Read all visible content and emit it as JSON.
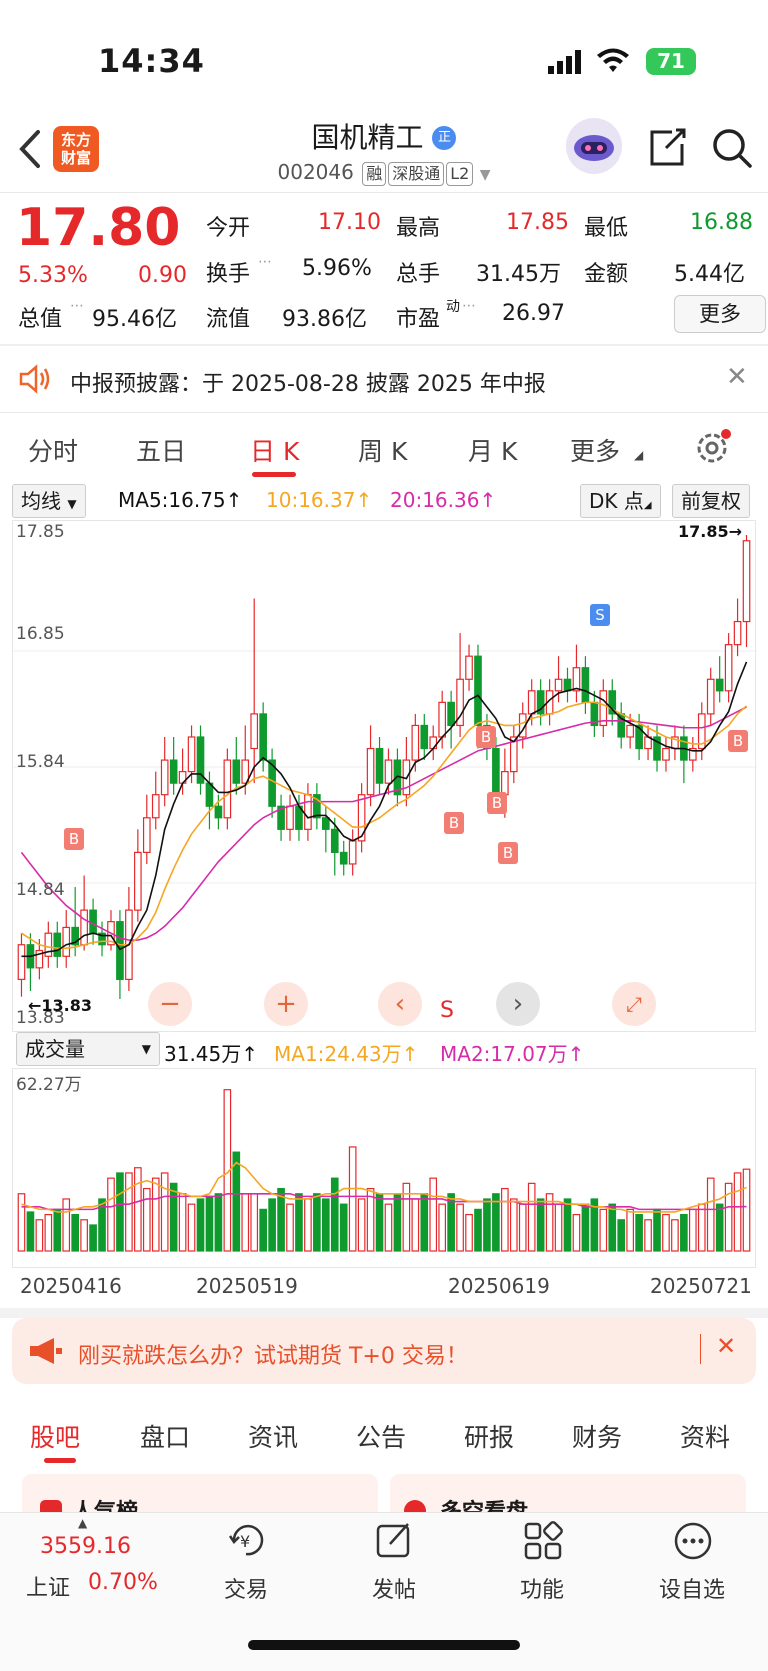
{
  "status_bar": {
    "time": "14:34",
    "battery": "71"
  },
  "header": {
    "logo_line1": "东方",
    "logo_line2": "财富",
    "stock_name": "国机精工",
    "badge": "正",
    "code": "002046",
    "tags": [
      "融",
      "深股通",
      "L2"
    ]
  },
  "quote": {
    "price": "17.80",
    "change_pct": "5.33%",
    "change_amt": "0.90",
    "open_label": "今开",
    "open": "17.10",
    "high_label": "最高",
    "high": "17.85",
    "low_label": "最低",
    "low": "16.88",
    "turnover_label": "换手",
    "turnover": "5.96%",
    "volume_label": "总手",
    "volume": "31.45万",
    "amount_label": "金额",
    "amount": "5.44亿",
    "mktcap_label": "总值",
    "mktcap": "95.46亿",
    "float_label": "流值",
    "float": "93.86亿",
    "pe_label": "市盈",
    "pe_sup": "动",
    "pe": "26.97",
    "more_label": "更多"
  },
  "notice": {
    "text": "中报预披露：于 2025-08-28 披露 2025 年中报"
  },
  "chart_tabs": [
    "分时",
    "五日",
    "日 K",
    "周 K",
    "月 K",
    "更多"
  ],
  "active_tab": "日 K",
  "ma_bar": {
    "select": "均线",
    "ma5": "MA5:16.75",
    "ma10": "10:16.37",
    "ma20": "20:16.36",
    "dk": "DK 点",
    "adjust": "前复权"
  },
  "colors": {
    "up": "#e5292b",
    "down": "#0f9a2e",
    "ma5": "#111111",
    "ma10": "#f5a623",
    "ma20": "#d62ca8",
    "accent": "#e5292b"
  },
  "kline_axis": {
    "y_top": "17.85",
    "y2": "16.85",
    "y3": "15.84",
    "y4": "14.84",
    "y_bottom": "13.83",
    "max_mark": "17.85→",
    "min_mark": "←13.83"
  },
  "chart_markers": [
    "B",
    "B",
    "B",
    "B",
    "B",
    "S",
    "B"
  ],
  "chart_controls": {
    "s_label": "S"
  },
  "volume_bar": {
    "select": "成交量",
    "vol": "31.45万",
    "ma1": "MA1:24.43万",
    "ma2": "MA2:17.07万",
    "y_top": "62.27万"
  },
  "dates": [
    "20250416",
    "20250519",
    "20250619",
    "20250721"
  ],
  "chart_data": {
    "type": "candlestick",
    "ylim": [
      13.83,
      17.85
    ],
    "candles": [
      {
        "o": 14.0,
        "c": 14.3,
        "h": 14.4,
        "l": 13.85
      },
      {
        "o": 14.3,
        "c": 14.1,
        "h": 14.4,
        "l": 13.9
      },
      {
        "o": 14.1,
        "c": 14.25,
        "h": 14.35,
        "l": 14.0
      },
      {
        "o": 14.2,
        "c": 14.4,
        "h": 14.5,
        "l": 14.1
      },
      {
        "o": 14.4,
        "c": 14.2,
        "h": 14.5,
        "l": 14.1
      },
      {
        "o": 14.2,
        "c": 14.45,
        "h": 14.6,
        "l": 14.1
      },
      {
        "o": 14.45,
        "c": 14.3,
        "h": 14.8,
        "l": 14.2
      },
      {
        "o": 14.3,
        "c": 14.6,
        "h": 14.9,
        "l": 14.25
      },
      {
        "o": 14.6,
        "c": 14.4,
        "h": 14.7,
        "l": 14.3
      },
      {
        "o": 14.4,
        "c": 14.3,
        "h": 14.5,
        "l": 14.2
      },
      {
        "o": 14.3,
        "c": 14.5,
        "h": 14.6,
        "l": 14.25
      },
      {
        "o": 14.5,
        "c": 14.0,
        "h": 14.6,
        "l": 13.83
      },
      {
        "o": 14.0,
        "c": 14.6,
        "h": 14.8,
        "l": 13.9
      },
      {
        "o": 14.6,
        "c": 15.1,
        "h": 15.3,
        "l": 14.5
      },
      {
        "o": 15.1,
        "c": 15.4,
        "h": 15.6,
        "l": 15.0
      },
      {
        "o": 15.4,
        "c": 15.6,
        "h": 15.8,
        "l": 15.3
      },
      {
        "o": 15.6,
        "c": 15.9,
        "h": 16.1,
        "l": 15.5
      },
      {
        "o": 15.9,
        "c": 15.7,
        "h": 16.1,
        "l": 15.6
      },
      {
        "o": 15.7,
        "c": 15.8,
        "h": 16.0,
        "l": 15.6
      },
      {
        "o": 15.8,
        "c": 16.1,
        "h": 16.2,
        "l": 15.7
      },
      {
        "o": 16.1,
        "c": 15.7,
        "h": 16.2,
        "l": 15.6
      },
      {
        "o": 15.7,
        "c": 15.5,
        "h": 15.8,
        "l": 15.3
      },
      {
        "o": 15.5,
        "c": 15.4,
        "h": 15.6,
        "l": 15.3
      },
      {
        "o": 15.4,
        "c": 15.9,
        "h": 16.0,
        "l": 15.3
      },
      {
        "o": 15.9,
        "c": 15.7,
        "h": 16.1,
        "l": 15.6
      },
      {
        "o": 15.7,
        "c": 15.9,
        "h": 16.2,
        "l": 15.6
      },
      {
        "o": 16.0,
        "c": 16.3,
        "h": 17.3,
        "l": 15.7
      },
      {
        "o": 16.3,
        "c": 15.9,
        "h": 16.4,
        "l": 15.8
      },
      {
        "o": 15.9,
        "c": 15.5,
        "h": 16.0,
        "l": 15.4
      },
      {
        "o": 15.5,
        "c": 15.3,
        "h": 15.6,
        "l": 15.2
      },
      {
        "o": 15.3,
        "c": 15.5,
        "h": 15.6,
        "l": 15.2
      },
      {
        "o": 15.5,
        "c": 15.3,
        "h": 15.6,
        "l": 15.2
      },
      {
        "o": 15.3,
        "c": 15.6,
        "h": 15.7,
        "l": 15.2
      },
      {
        "o": 15.6,
        "c": 15.4,
        "h": 15.7,
        "l": 15.3
      },
      {
        "o": 15.4,
        "c": 15.3,
        "h": 15.5,
        "l": 15.1
      },
      {
        "o": 15.3,
        "c": 15.1,
        "h": 15.4,
        "l": 14.9
      },
      {
        "o": 15.1,
        "c": 15.0,
        "h": 15.2,
        "l": 14.9
      },
      {
        "o": 15.0,
        "c": 15.2,
        "h": 15.3,
        "l": 14.9
      },
      {
        "o": 15.2,
        "c": 15.6,
        "h": 15.7,
        "l": 15.1
      },
      {
        "o": 15.6,
        "c": 16.0,
        "h": 16.2,
        "l": 15.5
      },
      {
        "o": 16.0,
        "c": 15.7,
        "h": 16.1,
        "l": 15.6
      },
      {
        "o": 15.7,
        "c": 15.9,
        "h": 16.0,
        "l": 15.6
      },
      {
        "o": 15.9,
        "c": 15.6,
        "h": 16.0,
        "l": 15.5
      },
      {
        "o": 15.6,
        "c": 15.9,
        "h": 16.1,
        "l": 15.5
      },
      {
        "o": 15.9,
        "c": 16.2,
        "h": 16.3,
        "l": 15.8
      },
      {
        "o": 16.2,
        "c": 16.0,
        "h": 16.3,
        "l": 15.9
      },
      {
        "o": 16.0,
        "c": 16.1,
        "h": 16.2,
        "l": 15.9
      },
      {
        "o": 16.1,
        "c": 16.4,
        "h": 16.5,
        "l": 16.0
      },
      {
        "o": 16.4,
        "c": 16.2,
        "h": 16.5,
        "l": 16.0
      },
      {
        "o": 16.2,
        "c": 16.6,
        "h": 17.0,
        "l": 16.1
      },
      {
        "o": 16.6,
        "c": 16.8,
        "h": 16.9,
        "l": 16.5
      },
      {
        "o": 16.8,
        "c": 16.2,
        "h": 16.9,
        "l": 16.0
      },
      {
        "o": 16.2,
        "c": 16.0,
        "h": 16.3,
        "l": 15.9
      },
      {
        "o": 16.0,
        "c": 15.6,
        "h": 16.1,
        "l": 15.5
      },
      {
        "o": 15.6,
        "c": 15.8,
        "h": 16.0,
        "l": 15.4
      },
      {
        "o": 15.8,
        "c": 16.1,
        "h": 16.2,
        "l": 15.7
      },
      {
        "o": 16.1,
        "c": 16.3,
        "h": 16.4,
        "l": 16.0
      },
      {
        "o": 16.3,
        "c": 16.5,
        "h": 16.6,
        "l": 16.2
      },
      {
        "o": 16.5,
        "c": 16.3,
        "h": 16.6,
        "l": 16.2
      },
      {
        "o": 16.3,
        "c": 16.5,
        "h": 16.6,
        "l": 16.2
      },
      {
        "o": 16.5,
        "c": 16.6,
        "h": 16.8,
        "l": 16.4
      },
      {
        "o": 16.6,
        "c": 16.5,
        "h": 16.7,
        "l": 16.4
      },
      {
        "o": 16.5,
        "c": 16.7,
        "h": 16.9,
        "l": 16.4
      },
      {
        "o": 16.7,
        "c": 16.4,
        "h": 16.8,
        "l": 16.3
      },
      {
        "o": 16.4,
        "c": 16.2,
        "h": 16.5,
        "l": 16.1
      },
      {
        "o": 16.2,
        "c": 16.5,
        "h": 16.6,
        "l": 16.1
      },
      {
        "o": 16.5,
        "c": 16.3,
        "h": 16.6,
        "l": 16.2
      },
      {
        "o": 16.3,
        "c": 16.1,
        "h": 16.4,
        "l": 16.0
      },
      {
        "o": 16.1,
        "c": 16.2,
        "h": 16.3,
        "l": 16.0
      },
      {
        "o": 16.2,
        "c": 16.0,
        "h": 16.3,
        "l": 15.9
      },
      {
        "o": 16.0,
        "c": 16.1,
        "h": 16.2,
        "l": 15.9
      },
      {
        "o": 16.1,
        "c": 15.9,
        "h": 16.2,
        "l": 15.8
      },
      {
        "o": 15.9,
        "c": 16.0,
        "h": 16.1,
        "l": 15.8
      },
      {
        "o": 16.0,
        "c": 16.1,
        "h": 16.2,
        "l": 15.9
      },
      {
        "o": 16.1,
        "c": 15.9,
        "h": 16.2,
        "l": 15.7
      },
      {
        "o": 15.9,
        "c": 16.0,
        "h": 16.1,
        "l": 15.8
      },
      {
        "o": 16.0,
        "c": 16.3,
        "h": 16.4,
        "l": 15.9
      },
      {
        "o": 16.3,
        "c": 16.6,
        "h": 16.7,
        "l": 16.2
      },
      {
        "o": 16.6,
        "c": 16.5,
        "h": 16.8,
        "l": 16.4
      },
      {
        "o": 16.5,
        "c": 16.9,
        "h": 17.0,
        "l": 16.4
      },
      {
        "o": 16.9,
        "c": 17.1,
        "h": 17.3,
        "l": 16.8
      },
      {
        "o": 17.1,
        "c": 17.8,
        "h": 17.85,
        "l": 16.88
      }
    ],
    "ma5": [
      14.2,
      14.2,
      14.22,
      14.24,
      14.25,
      14.3,
      14.32,
      14.38,
      14.4,
      14.38,
      14.38,
      14.26,
      14.3,
      14.46,
      14.6,
      14.9,
      15.3,
      15.52,
      15.7,
      15.78,
      15.78,
      15.7,
      15.62,
      15.62,
      15.64,
      15.68,
      15.84,
      15.92,
      15.86,
      15.78,
      15.66,
      15.5,
      15.4,
      15.42,
      15.42,
      15.34,
      15.24,
      15.2,
      15.24,
      15.38,
      15.5,
      15.68,
      15.76,
      15.74,
      15.88,
      15.92,
      16.0,
      16.1,
      16.18,
      16.28,
      16.42,
      16.46,
      16.36,
      16.26,
      16.1,
      16.06,
      16.16,
      16.3,
      16.34,
      16.42,
      16.48,
      16.5,
      16.52,
      16.5,
      16.46,
      16.42,
      16.34,
      16.26,
      16.22,
      16.18,
      16.1,
      16.06,
      16.02,
      16.0,
      16.0,
      15.98,
      15.98,
      16.06,
      16.2,
      16.32,
      16.56,
      16.75
    ],
    "ma10": [
      14.4,
      14.35,
      14.3,
      14.28,
      14.27,
      14.27,
      14.28,
      14.3,
      14.32,
      14.33,
      14.33,
      14.3,
      14.3,
      14.36,
      14.44,
      14.58,
      14.78,
      14.96,
      15.12,
      15.26,
      15.36,
      15.46,
      15.54,
      15.6,
      15.66,
      15.68,
      15.74,
      15.76,
      15.72,
      15.68,
      15.64,
      15.62,
      15.6,
      15.56,
      15.5,
      15.44,
      15.38,
      15.32,
      15.32,
      15.36,
      15.4,
      15.46,
      15.52,
      15.56,
      15.62,
      15.68,
      15.76,
      15.86,
      15.96,
      16.06,
      16.16,
      16.22,
      16.24,
      16.22,
      16.2,
      16.2,
      16.22,
      16.26,
      16.28,
      16.3,
      16.32,
      16.36,
      16.38,
      16.4,
      16.4,
      16.38,
      16.34,
      16.3,
      16.26,
      16.22,
      16.18,
      16.14,
      16.1,
      16.08,
      16.06,
      16.04,
      16.04,
      16.08,
      16.14,
      16.2,
      16.3,
      16.37
    ],
    "ma20": [
      15.1,
      15.0,
      14.9,
      14.8,
      14.72,
      14.64,
      14.58,
      14.52,
      14.48,
      14.44,
      14.4,
      14.36,
      14.34,
      14.34,
      14.36,
      14.4,
      14.46,
      14.54,
      14.62,
      14.72,
      14.82,
      14.92,
      15.02,
      15.1,
      15.18,
      15.26,
      15.34,
      15.4,
      15.44,
      15.48,
      15.5,
      15.52,
      15.54,
      15.54,
      15.54,
      15.54,
      15.54,
      15.54,
      15.56,
      15.58,
      15.6,
      15.62,
      15.64,
      15.66,
      15.7,
      15.74,
      15.78,
      15.82,
      15.86,
      15.9,
      15.94,
      15.98,
      16.0,
      16.02,
      16.04,
      16.06,
      16.08,
      16.1,
      16.12,
      16.14,
      16.16,
      16.18,
      16.2,
      16.22,
      16.23,
      16.24,
      16.24,
      16.24,
      16.24,
      16.23,
      16.22,
      16.21,
      16.2,
      16.19,
      16.18,
      16.18,
      16.18,
      16.2,
      16.24,
      16.28,
      16.32,
      16.36
    ],
    "volume": [
      22,
      15,
      12,
      14,
      16,
      20,
      14,
      12,
      10,
      20,
      28,
      30,
      30,
      32,
      24,
      28,
      30,
      26,
      22,
      18,
      20,
      21,
      22,
      62,
      38,
      22,
      22,
      16,
      20,
      24,
      18,
      22,
      20,
      22,
      20,
      28,
      18,
      40,
      20,
      24,
      22,
      18,
      22,
      26,
      20,
      22,
      28,
      18,
      22,
      18,
      14,
      16,
      20,
      22,
      24,
      20,
      18,
      26,
      20,
      22,
      18,
      20,
      14,
      18,
      20,
      16,
      18,
      12,
      16,
      14,
      12,
      16,
      14,
      12,
      14,
      16,
      18,
      28,
      18,
      26,
      30,
      31.45
    ],
    "vol_ma1": [
      18,
      17,
      16,
      16,
      15,
      15,
      16,
      17,
      17,
      18,
      20,
      22,
      24,
      26,
      27,
      26,
      24,
      23,
      22,
      21,
      21,
      22,
      28,
      30,
      34,
      32,
      28,
      24,
      22,
      21,
      20,
      20,
      20,
      21,
      22,
      22,
      24,
      24,
      24,
      23,
      22,
      22,
      22,
      22,
      22,
      22,
      21,
      21,
      20,
      20,
      19,
      19,
      19,
      19,
      19,
      19,
      19,
      19,
      19,
      19,
      19,
      18,
      18,
      18,
      17,
      17,
      16,
      16,
      15,
      15,
      15,
      15,
      15,
      15,
      16,
      17,
      18,
      19,
      20,
      22,
      23,
      24.43
    ],
    "vol_ma2": [
      17,
      17,
      17,
      16,
      16,
      16,
      16,
      16,
      16,
      17,
      17,
      18,
      18,
      19,
      20,
      20,
      21,
      21,
      21,
      21,
      21,
      21,
      21,
      22,
      22,
      22,
      22,
      22,
      22,
      22,
      22,
      21,
      21,
      21,
      21,
      21,
      21,
      21,
      21,
      21,
      20,
      20,
      20,
      20,
      20,
      20,
      20,
      20,
      19,
      19,
      19,
      19,
      19,
      19,
      19,
      19,
      18,
      18,
      18,
      18,
      18,
      18,
      18,
      17,
      17,
      17,
      17,
      17,
      17,
      16,
      16,
      16,
      16,
      16,
      16,
      16,
      16,
      16,
      16,
      17,
      17,
      17.07
    ]
  },
  "banner": {
    "text": "刚买就跌怎么办？试试期货 T+0 交易！"
  },
  "bottom_tabs": [
    "股吧",
    "盘口",
    "资讯",
    "公告",
    "研报",
    "财务",
    "资料"
  ],
  "cards": [
    "人气榜",
    "多空看盘"
  ],
  "index": {
    "value": "3559.16",
    "name": "上证",
    "change": "0.70%"
  },
  "nav": [
    "交易",
    "发帖",
    "功能",
    "设自选"
  ]
}
